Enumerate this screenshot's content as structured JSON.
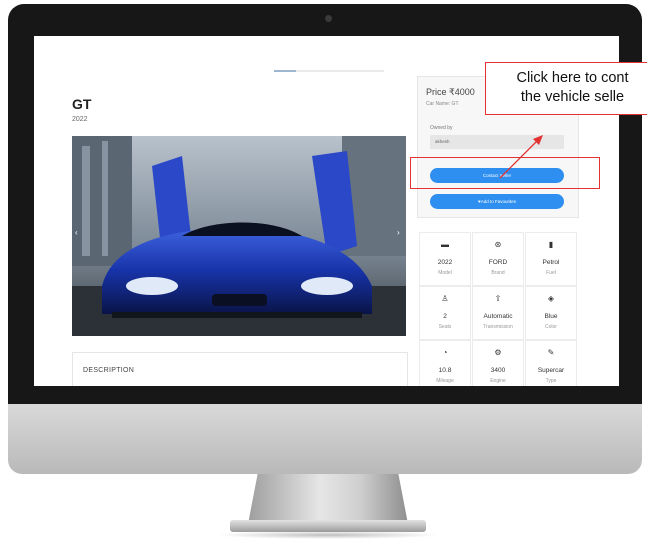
{
  "page": {
    "title": "GT",
    "year": "2022",
    "description_heading": "DESCRIPTION",
    "carousel": {
      "prev": "‹",
      "next": "›",
      "progress": 0.2
    }
  },
  "side_panel": {
    "price": "Price ₹4000",
    "car_name": "Car Name: GT",
    "owned_by_label": "Owned by",
    "owner": "akhesh",
    "contact_button": "Contact Seller",
    "favorites_button": "♥Add to Favourites"
  },
  "specs": [
    {
      "icon": "car-icon",
      "glyph": "▬",
      "value": "2022",
      "label": "Model"
    },
    {
      "icon": "steering-wheel-icon",
      "glyph": "⊛",
      "value": "FORD",
      "label": "Brand"
    },
    {
      "icon": "fuel-pump-icon",
      "glyph": "▮",
      "value": "Petrol",
      "label": "Fuel"
    },
    {
      "icon": "seat-icon",
      "glyph": "♙",
      "value": "2",
      "label": "Seats"
    },
    {
      "icon": "gear-shift-icon",
      "glyph": "⇧",
      "value": "Automatic",
      "label": "Transmission"
    },
    {
      "icon": "paint-bucket-icon",
      "glyph": "◈",
      "value": "Blue",
      "label": "Color"
    },
    {
      "icon": "speedometer-icon",
      "glyph": "◔",
      "value": "10.8",
      "label": "Mileage"
    },
    {
      "icon": "engine-icon",
      "glyph": "⚙",
      "value": "3400",
      "label": "Engine"
    },
    {
      "icon": "wrench-icon",
      "glyph": "✎",
      "value": "Supercar",
      "label": "Type"
    }
  ],
  "annotation": {
    "line1": "Click here to cont",
    "line2": "the vehicle selle",
    "color": "#e23232"
  },
  "colors": {
    "accent": "#2e8ff0",
    "bezel": "#171717"
  }
}
